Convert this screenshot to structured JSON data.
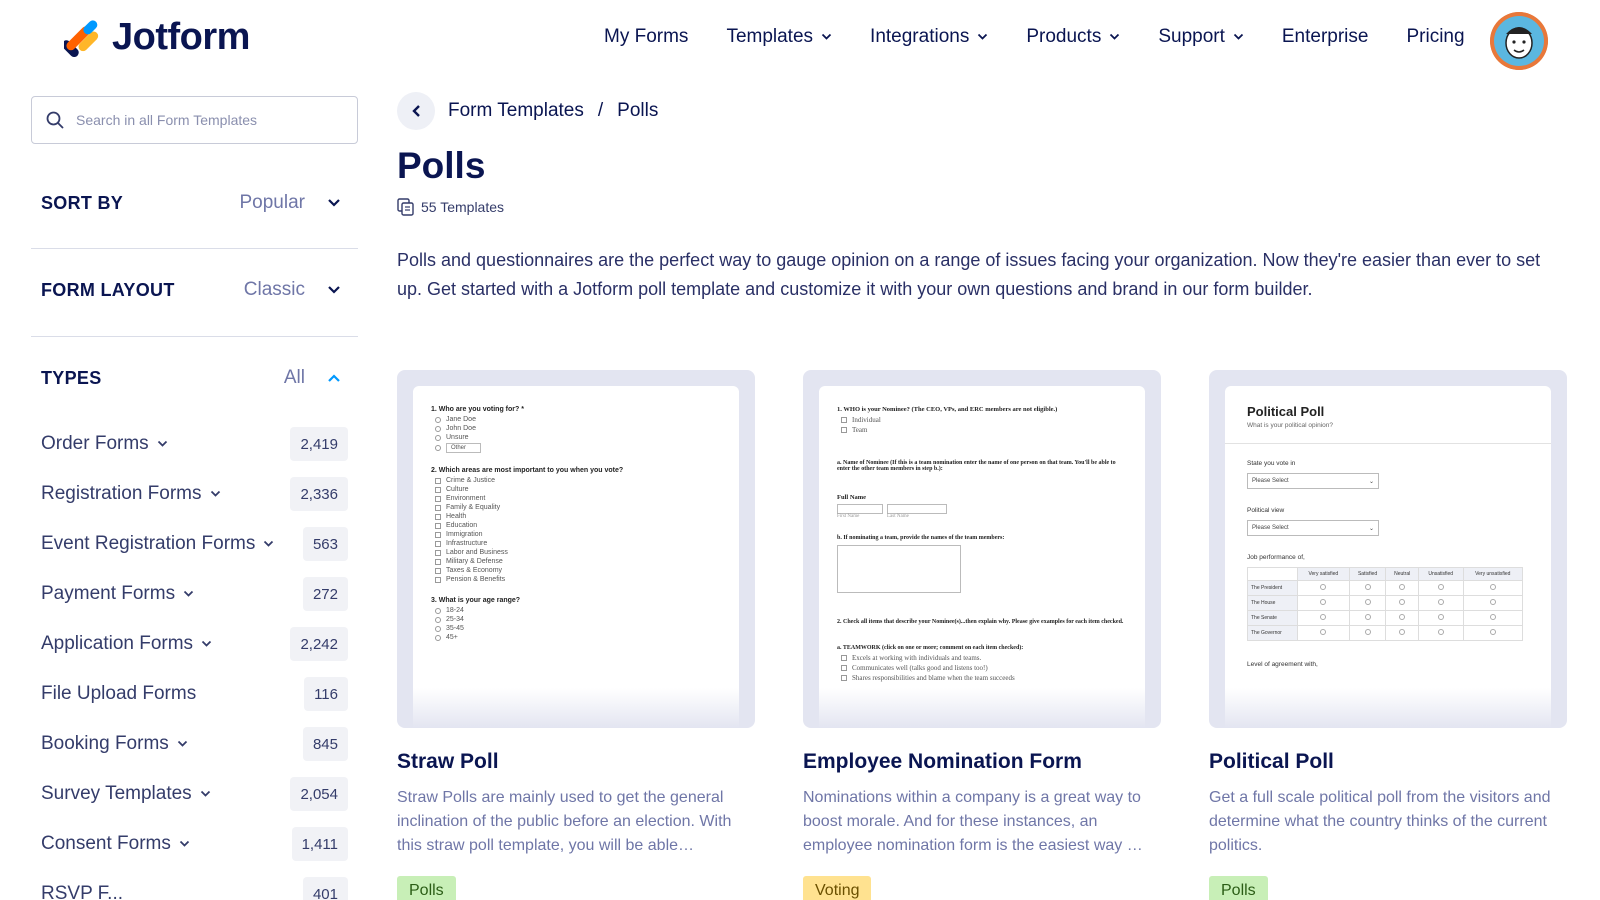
{
  "header": {
    "logo_text": "Jotform",
    "nav": [
      {
        "label": "My Forms",
        "dropdown": false
      },
      {
        "label": "Templates",
        "dropdown": true
      },
      {
        "label": "Integrations",
        "dropdown": true
      },
      {
        "label": "Products",
        "dropdown": true
      },
      {
        "label": "Support",
        "dropdown": true
      },
      {
        "label": "Enterprise",
        "dropdown": false
      },
      {
        "label": "Pricing",
        "dropdown": false
      }
    ]
  },
  "sidebar": {
    "search_placeholder": "Search in all Form Templates",
    "sort": {
      "title": "SORT BY",
      "value": "Popular"
    },
    "layout": {
      "title": "FORM LAYOUT",
      "value": "Classic"
    },
    "types": {
      "title": "TYPES",
      "value": "All"
    },
    "type_items": [
      {
        "label": "Order Forms",
        "count": "2,419",
        "expandable": true
      },
      {
        "label": "Registration Forms",
        "count": "2,336",
        "expandable": true
      },
      {
        "label": "Event Registration Forms",
        "count": "563",
        "expandable": true
      },
      {
        "label": "Payment Forms",
        "count": "272",
        "expandable": true
      },
      {
        "label": "Application Forms",
        "count": "2,242",
        "expandable": true
      },
      {
        "label": "File Upload Forms",
        "count": "116",
        "expandable": false
      },
      {
        "label": "Booking Forms",
        "count": "845",
        "expandable": true
      },
      {
        "label": "Survey Templates",
        "count": "2,054",
        "expandable": true
      },
      {
        "label": "Consent Forms",
        "count": "1,411",
        "expandable": true
      },
      {
        "label": "RSVP F...",
        "count": "401",
        "expandable": false
      }
    ]
  },
  "main": {
    "breadcrumb": {
      "parent": "Form Templates",
      "separator": "/",
      "current": "Polls"
    },
    "title": "Polls",
    "template_count": "55 Templates",
    "intro": "Polls and questionnaires are the perfect way to gauge opinion on a range of issues facing your organization. Now they're easier than ever to set up. Get started with a Jotform poll template and customize it with your own questions and brand in our form builder.",
    "cards": [
      {
        "title": "Straw Poll",
        "desc": "Straw Polls are mainly used to get the general inclination of the public before an election. With this straw poll template, you will be able…",
        "tag": "Polls",
        "tag_bg": "#c8efb7",
        "tag_fg": "#2b5d16",
        "preview": {
          "q1": "1. Who are you voting for? *",
          "q1_opts": [
            "Jane Doe",
            "John Doe",
            "Unsure"
          ],
          "q1_other": "Other",
          "q2": "2. Which areas are most important to you when you vote?",
          "q2_opts": [
            "Crime & Justice",
            "Culture",
            "Environment",
            "Family & Equality",
            "Health",
            "Education",
            "Immigration",
            "Infrastructure",
            "Labor and Business",
            "Military & Defense",
            "Taxes & Economy",
            "Pension & Benefits"
          ],
          "q3": "3. What is your age range?",
          "q3_opts": [
            "18-24",
            "25-34",
            "35-45",
            "45+"
          ]
        }
      },
      {
        "title": "Employee Nomination Form",
        "desc": "Nominations within a company is a great way to boost morale. And for these instances, an employee nomination form is the easiest way …",
        "tag": "Voting",
        "tag_bg": "#ffe290",
        "tag_fg": "#6b5000",
        "preview": {
          "q1": "1. WHO is your Nominee? (The CEO, VPs, and ERC members are not eligible.)",
          "q1_opts": [
            "Individual",
            "Team"
          ],
          "q2": "a. Name of Nominee (If this is a team nomination enter the name of one person on that team. You'll be able to enter the other team members in step b.):",
          "full_name": "Full Name",
          "first_name": "First Name",
          "last_name": "Last Name",
          "q3": "b. If nominating a team, provide the names of the team members:",
          "q4": "2. Check all items that describe your Nominee(s)...then explain why. Please give examples for each item checked.",
          "q5": "a. TEAMWORK (click on one or more; comment on each item checked):",
          "q5_opts": [
            "Excels at working with individuals and teams.",
            "Communicates well (talks good and listens too!)",
            "Shares responsibilities and blame when the team succeeds"
          ]
        }
      },
      {
        "title": "Political Poll",
        "desc": "Get a full scale political poll from the visitors and determine what the country thinks of the current politics.",
        "tag": "Polls",
        "tag_bg": "#c8efb7",
        "tag_fg": "#2b5d16",
        "preview": {
          "heading": "Political Poll",
          "sub": "What is your political opinion?",
          "l1": "State you vote in",
          "select": "Please Select",
          "l2": "Political view",
          "l3": "Job performance of,",
          "cols": [
            "Very satisfied",
            "Satisfied",
            "Neutral",
            "Unsatisfied",
            "Very unsatisfied"
          ],
          "rows": [
            "The President",
            "The House",
            "The Senate",
            "The Governor"
          ],
          "l4": "Level of agreement with,"
        }
      }
    ]
  },
  "colors": {
    "brand_navy": "#0a1551",
    "muted": "#6f76a7",
    "logo_orange": "#ff6100",
    "logo_blue": "#0099ff",
    "logo_yellow": "#ffb629"
  }
}
